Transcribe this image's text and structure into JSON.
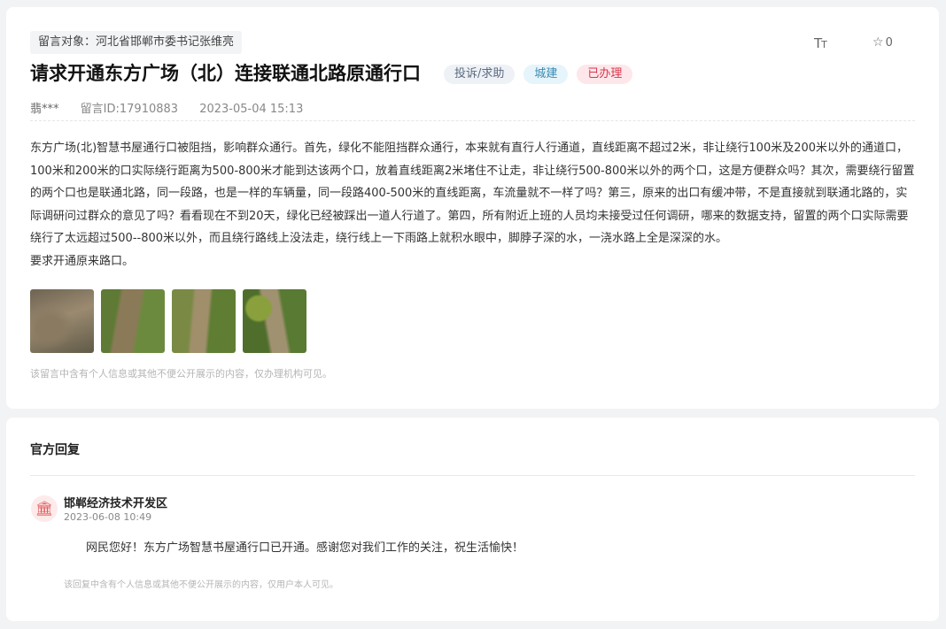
{
  "post": {
    "target_label": "留言对象：河北省邯郸市委书记张维亮",
    "font_toggle_big": "T",
    "font_toggle_small": "T",
    "favorite_icon": "star-outline-icon",
    "favorite_count": "0",
    "title": "请求开通东方广场（北）连接联通北路原通行口",
    "badges": {
      "type": "投诉/求助",
      "category": "城建",
      "status": "已办理"
    },
    "author": "翡***",
    "message_id": "留言ID:17910883",
    "datetime": "2023-05-04 15:13",
    "content": [
      "东方广场(北)智慧书屋通行口被阻挡，影响群众通行。首先，绿化不能阻挡群众通行，本来就有直行人行通道，直线距离不超过2米，非让绕行100米及200米以外的通道口，100米和200米的口实际绕行距离为500-800米才能到达该两个口，放着直线距离2米堵住不让走，非让绕行500-800米以外的两个口，这是方便群众吗？其次，需要绕行留置的两个口也是联通北路，同一段路，也是一样的车辆量，同一段路400-500米的直线距离，车流量就不一样了吗？第三，原来的出口有缓冲带，不是直接就到联通北路的，实际调研问过群众的意见了吗？看看现在不到20天，绿化已经被踩出一道人行道了。第四，所有附近上班的人员均未接受过任何调研，哪来的数据支持，留置的两个口实际需要绕行了太远超过500--800米以外，而且绕行路线上没法走，绕行线上一下雨路上就积水眼中，脚脖子深的水，一浇水路上全是深深的水。",
      "要求开通原来路口。"
    ],
    "privacy_note": "该留言中含有个人信息或其他不便公开展示的内容，仅办理机构可见。"
  },
  "reply": {
    "heading": "官方回复",
    "org_icon": "government-building-icon",
    "org_name": "邯郸经济技术开发区",
    "datetime": "2023-06-08 10:49",
    "text": "网民您好！东方广场智慧书屋通行口已开通。感谢您对我们工作的关注，祝生活愉快！",
    "privacy_note": "该回复中含有个人信息或其他不便公开展示的内容，仅用户本人可见。"
  }
}
